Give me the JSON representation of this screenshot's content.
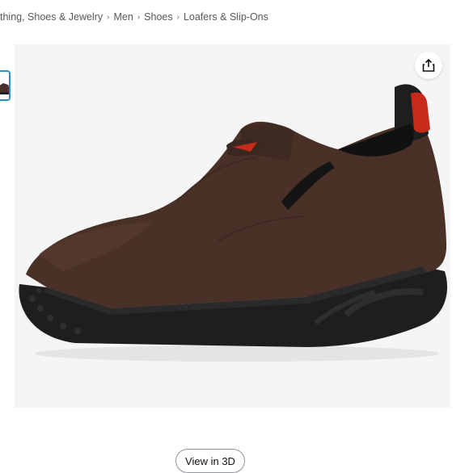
{
  "breadcrumb": {
    "items": [
      "thing, Shoes & Jewelry",
      "Men",
      "Shoes",
      "Loafers & Slip-Ons"
    ],
    "separator": "›"
  },
  "product_image": {
    "icon": "slip-on-work-shoe-photo",
    "colors": {
      "leather": "#4a3128",
      "sole": "#1e1e1e",
      "pull_tab": "#c62a1b",
      "background": "#f5f5f5"
    }
  },
  "share": {
    "icon": "share-icon"
  },
  "view3d": {
    "label": "View in 3D"
  }
}
